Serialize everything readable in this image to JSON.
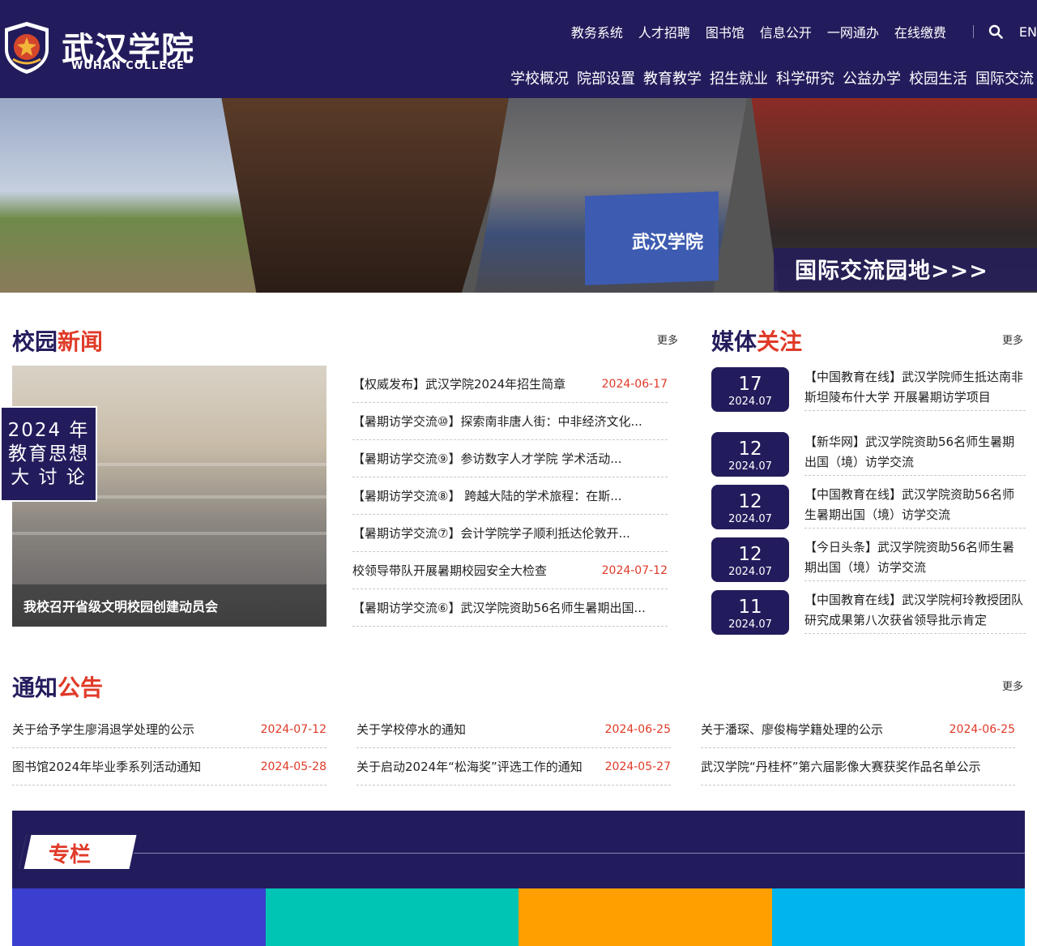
{
  "header": {
    "logo_cn": "武汉学院",
    "logo_en": "WUHAN COLLEGE",
    "top_links": [
      "教务系统",
      "人才招聘",
      "图书馆",
      "信息公开",
      "一网通办",
      "在线缴费"
    ],
    "lang": "EN",
    "main_nav": [
      "学校概况",
      "院部设置",
      "教育教学",
      "招生就业",
      "科学研究",
      "公益办学",
      "校园生活",
      "国际交流"
    ]
  },
  "banner": {
    "flag_text": "武汉学院",
    "caption": "国际交流园地>>>"
  },
  "campus_news": {
    "title_a": "校园",
    "title_b": "新闻",
    "more": "更多",
    "tag": "2024 年 教育思想 大 讨 论",
    "featured_caption": "我校召开省级文明校园创建动员会",
    "items": [
      {
        "title": "【权威发布】武汉学院2024年招生简章",
        "date": "2024-06-17"
      },
      {
        "title": "【暑期访学交流⑩】探索南非唐人街：中非经济文化...",
        "date": ""
      },
      {
        "title": "【暑期访学交流⑨】参访数字人才学院 学术活动...",
        "date": ""
      },
      {
        "title": "【暑期访学交流⑧】 跨越大陆的学术旅程：在斯...",
        "date": ""
      },
      {
        "title": "【暑期访学交流⑦】会计学院学子顺利抵达伦敦开...",
        "date": ""
      },
      {
        "title": "校领导带队开展暑期校园安全大检查",
        "date": "2024-07-12"
      },
      {
        "title": "【暑期访学交流⑥】武汉学院资助56名师生暑期出国...",
        "date": ""
      }
    ]
  },
  "media": {
    "title_a": "媒体",
    "title_b": "关注",
    "more": "更多",
    "items": [
      {
        "day": "17",
        "ym": "2024.07",
        "text": "【中国教育在线】武汉学院师生抵达南非斯坦陵布什大学 开展暑期访学项目"
      },
      {
        "day": "12",
        "ym": "2024.07",
        "text": "【新华网】武汉学院资助56名师生暑期出国（境）访学交流"
      },
      {
        "day": "12",
        "ym": "2024.07",
        "text": "【中国教育在线】武汉学院资助56名师生暑期出国（境）访学交流"
      },
      {
        "day": "12",
        "ym": "2024.07",
        "text": "【今日头条】武汉学院资助56名师生暑期出国（境）访学交流"
      },
      {
        "day": "11",
        "ym": "2024.07",
        "text": "【中国教育在线】武汉学院柯玲教授团队研究成果第八次获省领导批示肯定"
      }
    ]
  },
  "notices": {
    "title_a": "通知",
    "title_b": "公告",
    "more": "更多",
    "columns": [
      [
        {
          "title": "关于给予学生廖涓退学处理的公示",
          "date": "2024-07-12"
        },
        {
          "title": "图书馆2024年毕业季系列活动通知",
          "date": "2024-05-28"
        }
      ],
      [
        {
          "title": "关于学校停水的通知",
          "date": "2024-06-25"
        },
        {
          "title": "关于启动2024年“松海奖”评选工作的通知",
          "date": "2024-05-27"
        }
      ],
      [
        {
          "title": "关于潘琛、廖俊梅学籍处理的公示",
          "date": "2024-06-25"
        },
        {
          "title": "武汉学院“丹桂杯”第六届影像大赛获奖作品名单公示",
          "date": ""
        }
      ]
    ]
  },
  "special_column": {
    "title": "专栏",
    "tile_colors": [
      "#3b3fcf",
      "#00c4b4",
      "#ff9f00",
      "#00b5ec"
    ]
  },
  "colors": {
    "primary": "#231c5c",
    "accent": "#e03a28"
  }
}
